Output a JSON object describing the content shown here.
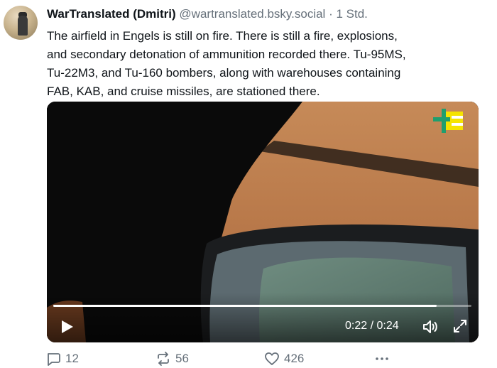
{
  "post": {
    "author_name": "WarTranslated (Dmitri)",
    "handle": "@wartranslated.bsky.social",
    "separator": "·",
    "time": "1 Std.",
    "text_lines": [
      "The airfield in Engels is still on fire. There is still a fire, explosions,",
      "and secondary detonation of ammunition recorded there. Tu-95MS,",
      "Tu-22M3, and Tu-160 bombers, along with warehouses containing",
      "FAB, KAB, and cruise missiles, are stationed there."
    ]
  },
  "video": {
    "time_display": "0:22 / 0:24",
    "progress_fraction": 0.9166,
    "icons": {
      "play": "play-icon",
      "mute": "speaker-icon",
      "fullscreen": "expand-icon",
      "logo": "channel-logo"
    }
  },
  "actions": {
    "replies": "12",
    "reposts": "56",
    "likes": "426",
    "icons": [
      "reply-icon",
      "repost-icon",
      "like-icon",
      "more-icon"
    ]
  },
  "colors": {
    "text": "#0f1419",
    "muted": "#66707a",
    "logo_yellow": "#f5e400",
    "logo_green": "#1f9e6e"
  }
}
